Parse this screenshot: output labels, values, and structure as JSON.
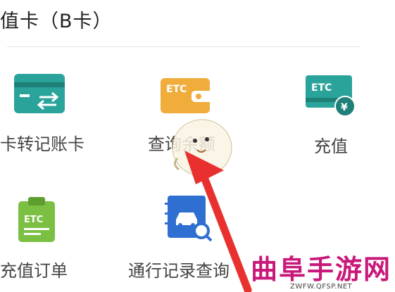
{
  "section_title": "值卡（B卡）",
  "grid_items": [
    {
      "label": "卡转记账卡",
      "icon": "card-transfer-icon",
      "color": "#2aa39b"
    },
    {
      "label": "查询余额",
      "icon": "etc-wallet-icon",
      "color": "#f0ad3c"
    },
    {
      "label": "充值",
      "icon": "etc-recharge-icon",
      "color": "#2aa39b"
    },
    {
      "label": "充值订单",
      "icon": "etc-order-clipboard-icon",
      "color": "#7bc043"
    },
    {
      "label": "通行记录查询",
      "icon": "car-record-search-icon",
      "color": "#2f6fd1"
    }
  ],
  "icon_text": "ETC",
  "watermark": {
    "title": "曲阜手游网",
    "url": "ZWFW.QFSP.NET"
  },
  "accent_colors": {
    "arrow": "#e8312f",
    "watermark": "#c8187a"
  }
}
